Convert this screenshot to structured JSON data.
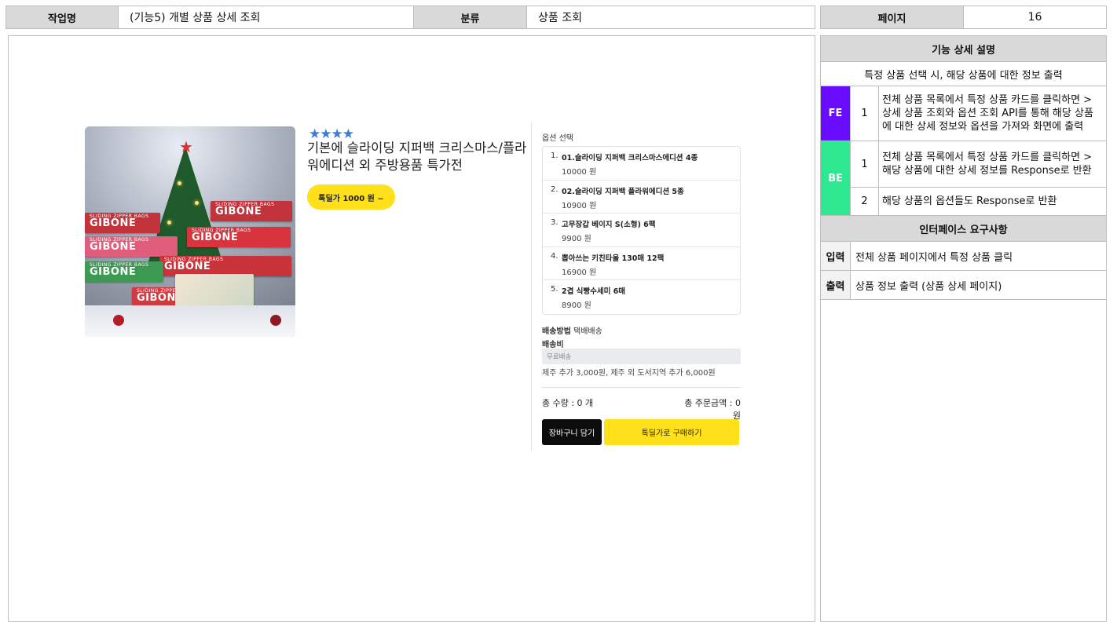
{
  "header": {
    "task_label": "작업명",
    "task_value": "(기능5) 개별 상품 상세 조회",
    "category_label": "분류",
    "category_value": "상품 조회",
    "page_label": "페이지",
    "page_value": "16"
  },
  "product": {
    "image_icon": "product-photo",
    "box_brand": "GIBONE",
    "box_subtitle": "SLIDING ZIPPER BAGS",
    "rating_stars": 4,
    "stars_text": "★★★★",
    "title": "기본에 슬라이딩 지퍼백 크리스마스/플라워에디션 외 주방용품 특가전",
    "price_button": "톡딜가 1000 원 ~"
  },
  "options": {
    "title": "옵션 선택",
    "items": [
      {
        "num": "1.",
        "name": "01.슬라이딩 지퍼백 크리스마스에디션 4종",
        "price": "10000 원"
      },
      {
        "num": "2.",
        "name": "02.슬라이딩 지퍼백 플라워에디션 5종",
        "price": "10900 원"
      },
      {
        "num": "3.",
        "name": "고무장갑 베이지 S(소형) 6팩",
        "price": "9900 원"
      },
      {
        "num": "4.",
        "name": "뽑아쓰는 키친타올 130매 12팩",
        "price": "16900 원"
      },
      {
        "num": "5.",
        "name": "2겹 식빵수세미 6매",
        "price": "8900 원"
      }
    ]
  },
  "shipping": {
    "method_label": "배송방법",
    "method_value": "택배배송",
    "fee_label": "배송비",
    "fee_value": "무료배송",
    "note": "제주 추가 3,000원, 제주 외 도서지역 추가 6,000원"
  },
  "totals": {
    "quantity": "총 수량 : 0 개",
    "amount": "총 주문금액 : 0 원"
  },
  "buttons": {
    "cart": "장바구니 담기",
    "buy": "톡딜가로 구매하기"
  },
  "spec": {
    "func_head": "기능 상세 설명",
    "summary": "특정 상품 선택 시, 해당 상품에 대한 정보 출력",
    "fe_tag": "FE",
    "be_tag": "BE",
    "fe_rows": [
      {
        "num": "1",
        "text": "전체 상품 목록에서 특정 상품 카드를 클릭하면 > 상세 상품 조회와 옵션 조회 API를 통해 해당 상품에 대한 상세 정보와 옵션을 가져와 화면에 출력"
      }
    ],
    "be_rows": [
      {
        "num": "1",
        "text": "전체 상품 목록에서 특정 상품 카드를 클릭하면 > 해당 상품에 대한 상세 정보를 Response로 반환"
      },
      {
        "num": "2",
        "text": "해당 상품의 옵션들도 Response로 반환"
      }
    ],
    "iface_head": "인터페이스 요구사항",
    "input_label": "입력",
    "input_value": "전체 상품 페이지에서 특정 상품 클릭",
    "output_label": "출력",
    "output_value": "상품 정보 출력 (상품 상세 페이지)"
  },
  "colors": {
    "accent_yellow": "#ffe01b",
    "fe_purple": "#6a0dff",
    "be_green": "#2ee88f",
    "star_blue": "#3e7bd6"
  }
}
